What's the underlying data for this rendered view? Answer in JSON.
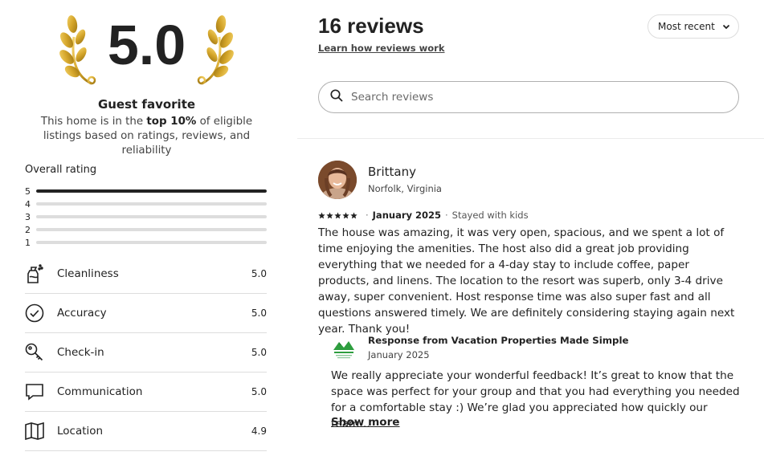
{
  "summary": {
    "score": "5.0",
    "title": "Guest favorite",
    "desc_pre": "This home is in the ",
    "desc_bold": "top 10%",
    "desc_post": " of eligible listings based on ratings, reviews, and reliability"
  },
  "overall": {
    "label": "Overall rating",
    "rows": [
      {
        "stars": "5",
        "fraction": 1.0
      },
      {
        "stars": "4",
        "fraction": 0.0
      },
      {
        "stars": "3",
        "fraction": 0.0
      },
      {
        "stars": "2",
        "fraction": 0.0
      },
      {
        "stars": "1",
        "fraction": 0.0
      }
    ]
  },
  "categories": [
    {
      "label": "Cleanliness",
      "score": "5.0",
      "icon": "spray-bottle-icon"
    },
    {
      "label": "Accuracy",
      "score": "5.0",
      "icon": "check-circle-icon"
    },
    {
      "label": "Check-in",
      "score": "5.0",
      "icon": "key-icon"
    },
    {
      "label": "Communication",
      "score": "5.0",
      "icon": "chat-bubble-icon"
    },
    {
      "label": "Location",
      "score": "4.9",
      "icon": "map-icon"
    }
  ],
  "reviews_header": {
    "count": "16 reviews",
    "learn_link": "Learn how reviews work",
    "sort_label": "Most recent",
    "search_placeholder": "Search reviews"
  },
  "review": {
    "name": "Brittany",
    "location": "Norfolk, Virginia",
    "rating": 5,
    "date": "January 2025",
    "stay": "Stayed with kids",
    "text": "The house was amazing, it was very open, spacious, and we spent a lot of time enjoying the amenities. The host also did a great job providing everything that we needed for a 4-day stay to include coffee, paper products, and linens. The location to the resort was superb, only 3-4 drive away, super convenient. Host response time was also super fast and all questions answered timely. We are definitely considering staying again next year. Thank you!",
    "response": {
      "title": "Response from Vacation Properties Made Simple",
      "date": "January 2025",
      "text": "We really appreciate your wonderful feedback! It’s great to know that the space was perfect for your group and that you had everything you needed for a comfortable stay :) We’re glad you appreciated how quickly our team…",
      "show_more": "Show more"
    }
  },
  "colors": {
    "gold": "#c9a227",
    "text": "#222222",
    "border": "#dddddd",
    "logo_green": "#2e9e3f"
  }
}
